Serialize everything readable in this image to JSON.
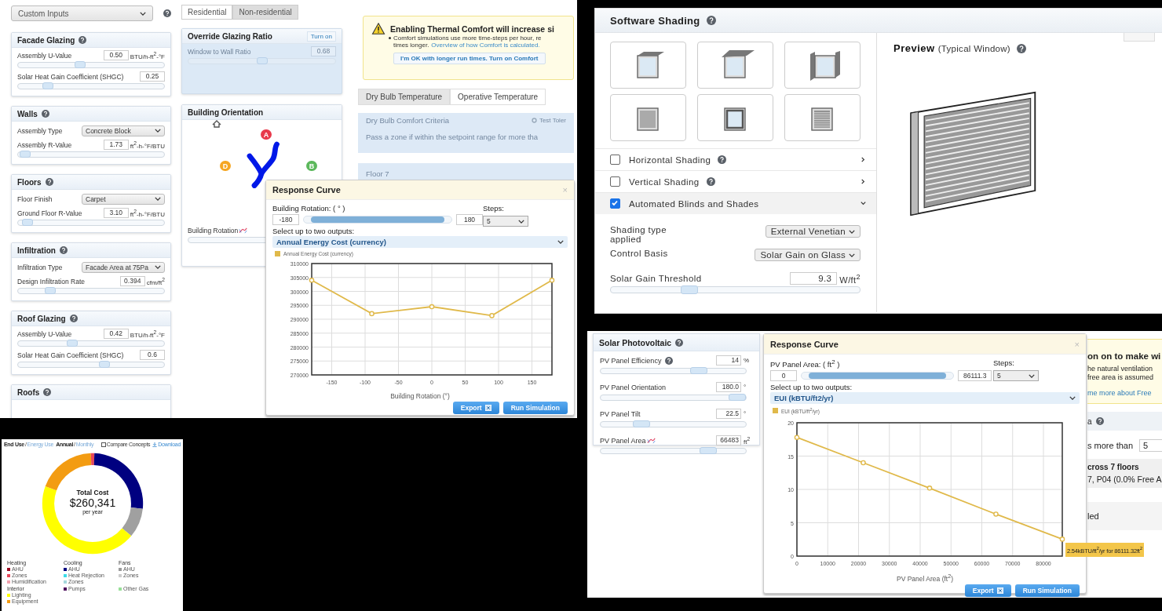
{
  "custom_inputs": {
    "preset": "Custom Inputs",
    "help": true,
    "sections": [
      {
        "title": "Facade Glazing",
        "help": true,
        "rows": [
          {
            "kind": "slider",
            "label": "Assembly U-Value",
            "value": "0.50",
            "unit": "BTU/h-ft$^{2}$-°F",
            "level": 0.42
          },
          {
            "kind": "slider",
            "label": "Solar Heat Gain Coefficient (SHGC)",
            "value": "0.25",
            "level": 0.18
          }
        ]
      },
      {
        "title": "Walls",
        "help": true,
        "rows": [
          {
            "kind": "select",
            "label": "Assembly Type",
            "value": "Concrete Block"
          },
          {
            "kind": "slider",
            "label": "Assembly R-Value",
            "value": "1.73",
            "unit": "ft$^{2}$-h-°F/BTU",
            "level": 0.01
          }
        ]
      },
      {
        "title": "Floors",
        "help": true,
        "rows": [
          {
            "kind": "select",
            "label": "Floor Finish",
            "value": "Carpet"
          },
          {
            "kind": "slider",
            "label": "Ground Floor R-Value",
            "value": "3.10",
            "unit": "ft$^{2}$-h-°F/BTU",
            "level": 0.03
          }
        ]
      },
      {
        "title": "Infiltration",
        "help": true,
        "rows": [
          {
            "kind": "select",
            "label": "Infiltration Type",
            "value": "Facade Area at 75Pa"
          },
          {
            "kind": "slider",
            "label": "Design Infiltration Rate",
            "value": "0.394",
            "unit": "cfm/ft$^{2}$",
            "level": 0.2
          }
        ]
      },
      {
        "title": "Roof Glazing",
        "help": true,
        "rows": [
          {
            "kind": "slider",
            "label": "Assembly U-Value",
            "value": "0.42",
            "unit": "BTU/h-ft$^{2}$-°F",
            "level": 0.36
          },
          {
            "kind": "slider",
            "label": "Solar Heat Gain Coefficient (SHGC)",
            "value": "0.6",
            "level": 0.6
          }
        ]
      },
      {
        "title": "Roofs",
        "help": true
      }
    ]
  },
  "building_type_tabs": [
    {
      "label": "Residential",
      "selected": false
    },
    {
      "label": "Non-residential",
      "selected": true
    }
  ],
  "override_glazing": {
    "title": "Override Glazing Ratio",
    "button": "Turn on",
    "label": "Window to Wall Ratio",
    "value": "0.68",
    "level": 0.5,
    "disabled": true
  },
  "orientation": {
    "title": "Building Orientation",
    "markers": [
      {
        "label": "A",
        "color": "#e8394b"
      },
      {
        "label": "D",
        "color": "#f5a623"
      },
      {
        "label": "B",
        "color": "#5cb85c"
      }
    ],
    "slider_label": "Building Rotation"
  },
  "comfort_alert": {
    "title": "Enabling Thermal Comfort will increase si",
    "line_1": "Comfort simulations use more time-steps per hour, re",
    "line_2": "times longer.",
    "link": "Overview of how Comfort is calculated.",
    "button": "I'm OK with longer run times. Turn on Comfort"
  },
  "comfort_tabs": [
    {
      "label": "Dry Bulb Temperature",
      "selected": true
    },
    {
      "label": "Operative Temperature",
      "selected": false
    }
  ],
  "comfort_criteria": {
    "title": "Dry Bulb Comfort Criteria",
    "option": "Test Toler",
    "text": "Pass a zone if within the setpoint range for more tha"
  },
  "floor": {
    "title": "Floor 7"
  },
  "rotation_curve": {
    "title": "Response Curve",
    "close": "×",
    "parameter": "Building Rotation: ( ° )",
    "min": "-180",
    "max": "180",
    "steps_label": "Steps:",
    "steps": "5",
    "outputs_label": "Select up to two outputs:",
    "output": "Annual Energy Cost (currency)",
    "chart_data": {
      "type": "line",
      "xlabel": "Building Rotation (°)",
      "x": [
        -180,
        -90,
        0,
        90,
        180
      ],
      "series": [
        {
          "name": "Annual Energy Cost (currency)",
          "color": "#e0b94a",
          "marker": "circle",
          "values": [
            304000,
            292000,
            294500,
            291300,
            304000
          ]
        }
      ],
      "xlim": [
        -180,
        180
      ],
      "ylim": [
        270000,
        310000
      ],
      "xticks": [
        -150,
        -100,
        -50,
        0,
        50,
        100,
        150
      ],
      "yticks": [
        270000,
        275000,
        280000,
        285000,
        290000,
        295000,
        300000,
        305000,
        310000
      ],
      "grid": true
    },
    "buttons": [
      {
        "label": "Export",
        "kind": "export"
      },
      {
        "label": "Run Simulation",
        "kind": "run"
      }
    ]
  },
  "software_shading": {
    "title": "Software Shading",
    "help": true,
    "tiles": [
      {
        "kind": "overhang"
      },
      {
        "kind": "awning"
      },
      {
        "kind": "fins"
      },
      {
        "kind": "recessed"
      },
      {
        "kind": "frame"
      },
      {
        "kind": "blinds"
      }
    ],
    "options": [
      {
        "label": "Horizontal Shading",
        "checked": false,
        "help": true,
        "expanded": false
      },
      {
        "label": "Vertical Shading",
        "checked": false,
        "help": true,
        "expanded": false
      },
      {
        "label": "Automated Blinds and Shades",
        "checked": true,
        "help": false,
        "expanded": true
      }
    ],
    "fields": [
      {
        "kind": "select",
        "label": "Shading type applied",
        "value": "External Venetian"
      },
      {
        "kind": "select",
        "label": "Control Basis",
        "value": "Solar Gain on Glass"
      },
      {
        "kind": "slider",
        "label": "Solar Gain Threshold",
        "value": "9.3",
        "unit": "W/ft$^{2}$",
        "level": 0.3
      }
    ],
    "preview": {
      "title": "Preview",
      "subtitle": "(Typical Window)",
      "help": true
    }
  },
  "cost_breakdown": {
    "view_toggle": {
      "items": [
        {
          "label": "End Use",
          "selected": true
        },
        {
          "label": "Energy Use",
          "selected": false
        }
      ],
      "separator": "/"
    },
    "period_toggle": {
      "items": [
        {
          "label": "Annual",
          "selected": true
        },
        {
          "label": "Monthly",
          "selected": false
        }
      ],
      "separator": "/"
    },
    "compare": {
      "label": "Compare Concepts",
      "checked": false
    },
    "download": "Download",
    "total_label": "Total Cost",
    "total": "$260,341",
    "total_unit": "per year",
    "legend": [
      {
        "heading": "Heating",
        "items": [
          {
            "label": "AHU",
            "color": "#9b0a22"
          },
          {
            "label": "Zones",
            "color": "#e8475a"
          },
          {
            "label": "Humidification",
            "color": "#f2a2ae"
          }
        ]
      },
      {
        "heading": "Cooling",
        "items": [
          {
            "label": "AHU",
            "color": "#000080"
          },
          {
            "label": "Heat Rejection",
            "color": "#3ddce8"
          },
          {
            "label": "Zones",
            "color": "#a6d8dc"
          }
        ]
      },
      {
        "heading": "Fans",
        "items": [
          {
            "label": "AHU",
            "color": "#9a9a9a"
          },
          {
            "label": "Zones",
            "color": "#cccccc"
          }
        ]
      },
      {
        "heading": "Interior",
        "items": [
          {
            "label": "Lighting",
            "color": "#ffff00"
          },
          {
            "label": "Equipment",
            "color": "#f39c12"
          }
        ]
      },
      {
        "items": [
          {
            "label": "Pumps",
            "color": "#4b0a5a"
          }
        ]
      },
      {
        "items": [
          {
            "label": "Other Gas",
            "color": "#98e098"
          }
        ]
      }
    ]
  },
  "solar_pv": {
    "title": "Solar Photovoltaic",
    "help": true,
    "rows": [
      {
        "label": "PV Panel Efficiency",
        "help": true,
        "curve": false,
        "value": "14",
        "unit": "%",
        "level": 0.7
      },
      {
        "label": "PV Panel Orientation",
        "help": false,
        "curve": false,
        "value": "180.0",
        "unit": "°",
        "level": 1
      },
      {
        "label": "PV Panel Tilt",
        "help": false,
        "curve": false,
        "value": "22.5",
        "unit": "°",
        "level": 0.25
      },
      {
        "label": "PV Panel Area",
        "help": false,
        "curve": true,
        "value": "66483",
        "unit": "ft$^{2}$",
        "level": 0.77
      }
    ]
  },
  "ventilation_behind": {
    "alert_title": "on on to make wi",
    "alert_lines": [
      "he natural ventilation",
      "free area is assumed"
    ],
    "alert_link": "me more about Free",
    "heading": "a",
    "threshold_label": "s more than",
    "threshold_value": "5",
    "summary_title": "cross 7 floors",
    "summary_text": "7, P04 (0.0% Free A",
    "status": "led"
  },
  "area_curve": {
    "title": "Response Curve",
    "close": "×",
    "parameter": "PV Panel Area: ( ft$^{2}$ )",
    "min": "0",
    "max": "86111.3",
    "steps_label": "Steps:",
    "steps": "5",
    "outputs_label": "Select up to two outputs:",
    "output": "EUI (kBTU/ft2/yr)",
    "chart_data": {
      "type": "line",
      "xlabel": "PV Panel Area (ft$^{2}$)",
      "x": [
        0,
        21528,
        43056,
        64583,
        86111
      ],
      "series": [
        {
          "name": "EUI (kBTU/ft$^{2}$/yr)",
          "color": "#e0b94a",
          "marker": "circle",
          "values": [
            17.8,
            14.0,
            10.2,
            6.3,
            2.54
          ]
        }
      ],
      "xlim": [
        0,
        86111.3
      ],
      "ylim": [
        0,
        20
      ],
      "xticks": [
        0,
        10000,
        20000,
        30000,
        40000,
        50000,
        60000,
        70000,
        80000
      ],
      "yticks": [
        0,
        5,
        10,
        15,
        20
      ],
      "grid": true
    },
    "tooltip": "2.54kBTU/ft$^{2}$/yr for 86111.32ft$^{2}$",
    "buttons": [
      {
        "label": "Export",
        "kind": "export"
      },
      {
        "label": "Run Simulation",
        "kind": "run"
      }
    ]
  }
}
